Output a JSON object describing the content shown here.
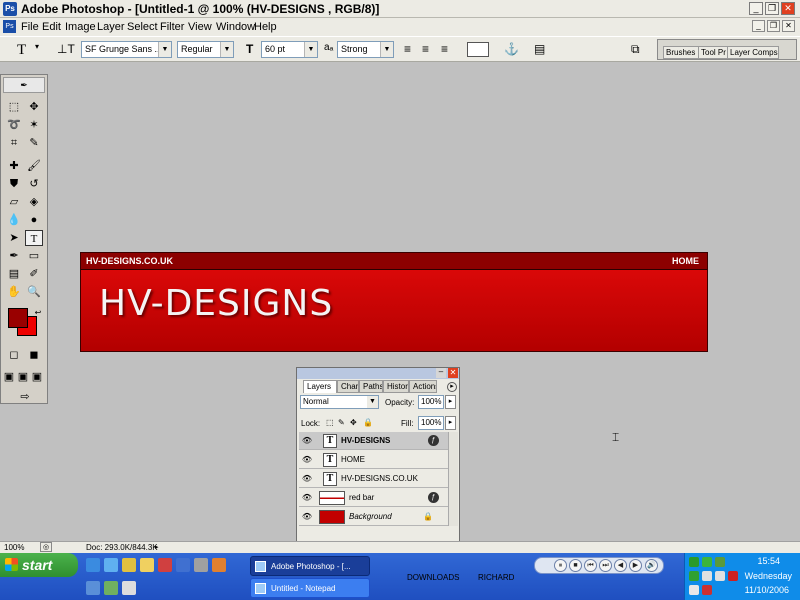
{
  "window": {
    "title": "Adobe Photoshop - [Untitled-1 @ 100% (HV-DESIGNS , RGB/8)]",
    "controls": [
      "_",
      "❐",
      "✕"
    ]
  },
  "menu": [
    "File",
    "Edit",
    "Image",
    "Layer",
    "Select",
    "Filter",
    "View",
    "Window",
    "Help"
  ],
  "options": {
    "font_family": "SF Grunge Sans ...",
    "font_style": "Regular",
    "font_size": "60 pt",
    "antialias": "Strong",
    "well_tabs": [
      "Brushes",
      "Tool Pr",
      "Layer Comps"
    ]
  },
  "canvas": {
    "site_small": "HV-DESIGNS.CO.UK",
    "home": "HOME",
    "logo": "HV-DESIGNS",
    "colors": {
      "banner": "#cc0000",
      "topbar": "#8c0000",
      "text": "#ffffff"
    }
  },
  "layers_panel": {
    "tabs": [
      "Layers",
      "Channels",
      "Paths",
      "History",
      "Actions"
    ],
    "blend_mode": "Normal",
    "opacity_label": "Opacity:",
    "opacity": "100%",
    "lock_label": "Lock:",
    "fill_label": "Fill:",
    "fill": "100%",
    "layers": [
      {
        "name": "HV-DESIGNS",
        "kind": "text",
        "selected": true,
        "fx": true
      },
      {
        "name": "HOME",
        "kind": "text"
      },
      {
        "name": "HV-DESIGNS.CO.UK",
        "kind": "text"
      },
      {
        "name": "red bar",
        "kind": "shape",
        "fx": true
      },
      {
        "name": "Background",
        "kind": "fill",
        "locked": true
      }
    ]
  },
  "status": {
    "zoom": "100%",
    "doc": "Doc: 293.0K/844.3K"
  },
  "taskbar": {
    "start": "start",
    "tasks": [
      {
        "label": "Adobe Photoshop - [...",
        "active": true
      },
      {
        "label": "Untitled - Notepad",
        "active": false
      }
    ],
    "toolbars": [
      "DOWNLOADS",
      "RICHARD"
    ],
    "media_controls": [
      "⏸",
      "■",
      "⏮",
      "⏭",
      "◀",
      "▶",
      "🔊"
    ],
    "clock": "15:54",
    "day": "Wednesday",
    "date": "11/10/2006"
  }
}
